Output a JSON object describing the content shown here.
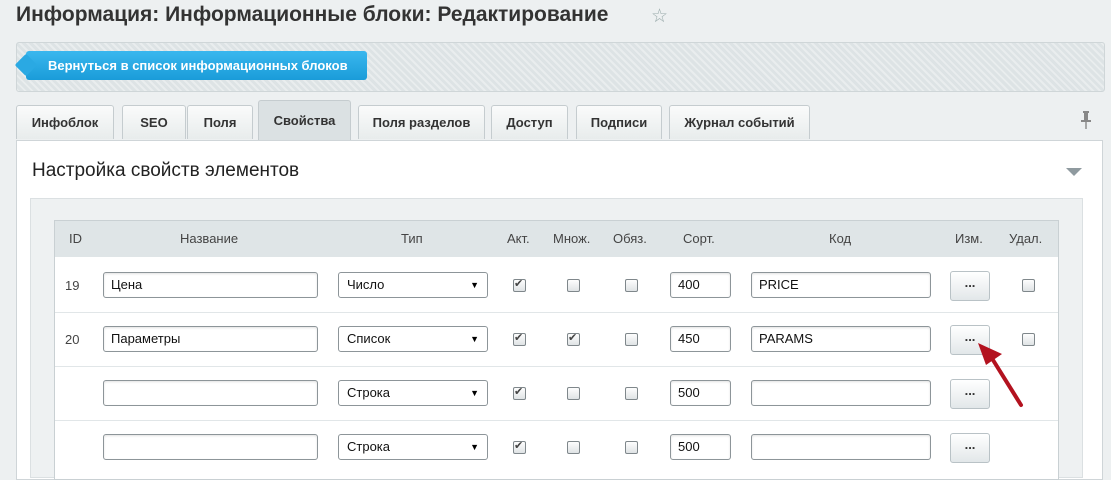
{
  "title": "Информация: Информационные блоки: Редактирование",
  "back_button": "Вернуться в список информационных блоков",
  "tabs": [
    {
      "label": "Инфоблок"
    },
    {
      "label": "SEO"
    },
    {
      "label": "Поля"
    },
    {
      "label": "Свойства"
    },
    {
      "label": "Поля разделов"
    },
    {
      "label": "Доступ"
    },
    {
      "label": "Подписи"
    },
    {
      "label": "Журнал событий"
    }
  ],
  "active_tab": "Свойства",
  "section_title": "Настройка свойств элементов",
  "columns": {
    "id": "ID",
    "name": "Название",
    "type": "Тип",
    "active": "Акт.",
    "multiple": "Множ.",
    "required": "Обяз.",
    "sort": "Сорт.",
    "code": "Код",
    "edit": "Изм.",
    "delete": "Удал."
  },
  "rows": [
    {
      "id": "19",
      "name": "Цена",
      "type": "Число",
      "active": true,
      "multiple": false,
      "required": false,
      "sort": "400",
      "code": "PRICE",
      "edit": "...",
      "has_delete": true
    },
    {
      "id": "20",
      "name": "Параметры",
      "type": "Список",
      "active": true,
      "multiple": true,
      "required": false,
      "sort": "450",
      "code": "PARAMS",
      "edit": "...",
      "has_delete": true
    },
    {
      "id": "",
      "name": "",
      "type": "Строка",
      "active": true,
      "multiple": false,
      "required": false,
      "sort": "500",
      "code": "",
      "edit": "...",
      "has_delete": false
    },
    {
      "id": "",
      "name": "",
      "type": "Строка",
      "active": true,
      "multiple": false,
      "required": false,
      "sort": "500",
      "code": "",
      "edit": "...",
      "has_delete": false
    }
  ],
  "colors": {
    "accent": "#1a9cd9",
    "annotation_arrow": "#b3121f"
  },
  "icons": {
    "favorite": "star-icon",
    "pin": "pin-icon",
    "collapse": "chevron-down-icon",
    "select": "dropdown-arrow-icon"
  }
}
